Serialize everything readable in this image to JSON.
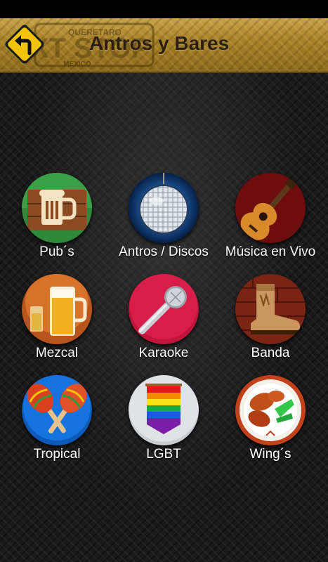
{
  "header": {
    "title": "Antros y Bares",
    "logo_text_main": "XT STOP",
    "logo_text_top": "QUERETARO",
    "logo_text_bottom": "MEXICO"
  },
  "categories": [
    {
      "label": "Pub´s",
      "icon": "beer-mug-icon"
    },
    {
      "label": "Antros / Discos",
      "icon": "disco-ball-icon"
    },
    {
      "label": "Música en Vivo",
      "icon": "guitar-icon"
    },
    {
      "label": "Mezcal",
      "icon": "mezcal-glasses-icon"
    },
    {
      "label": "Karaoke",
      "icon": "microphone-icon"
    },
    {
      "label": "Banda",
      "icon": "cowboy-boot-icon"
    },
    {
      "label": "Tropical",
      "icon": "maracas-icon"
    },
    {
      "label": "LGBT",
      "icon": "rainbow-flag-icon"
    },
    {
      "label": "Wing´s",
      "icon": "chicken-wings-icon"
    }
  ],
  "colors": {
    "header_gold": "#b8922f",
    "title_text": "#2a1f10",
    "label_text": "#ffffff",
    "back_sign_yellow": "#f2c300"
  }
}
